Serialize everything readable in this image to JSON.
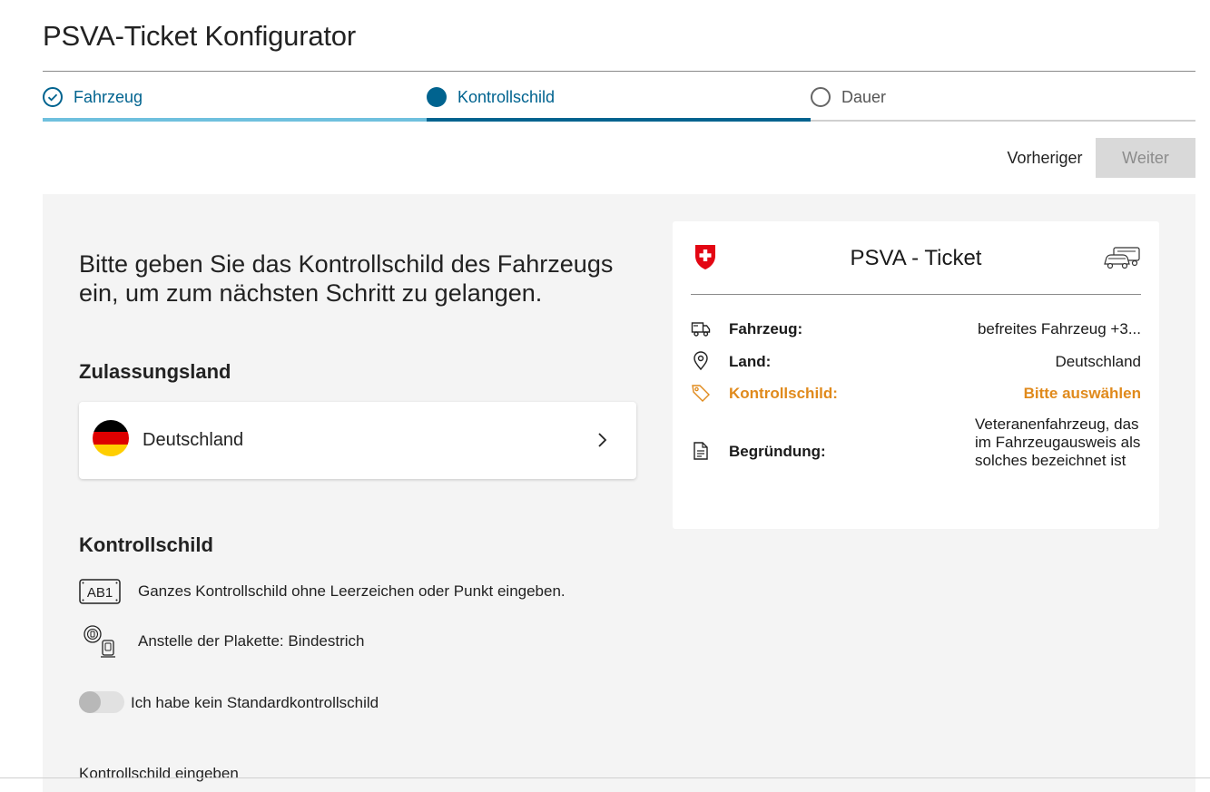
{
  "page": {
    "title": "PSVA-Ticket Konfigurator"
  },
  "stepper": {
    "steps": [
      {
        "label": "Fahrzeug",
        "state": "completed"
      },
      {
        "label": "Kontrollschild",
        "state": "active"
      },
      {
        "label": "Dauer",
        "state": "pending"
      }
    ]
  },
  "navigation": {
    "previous_label": "Vorheriger",
    "next_label": "Weiter",
    "next_disabled": true
  },
  "form": {
    "intro": "Bitte geben Sie das Kontrollschild des Fahrzeugs ein, um zum nächsten Schritt zu gelangen.",
    "country_section_title": "Zulassungsland",
    "country": {
      "name": "Deutschland",
      "flag_colors": [
        "#000000",
        "#dd0000",
        "#ffce00"
      ]
    },
    "plate_section_title": "Kontrollschild",
    "plate_icon_text": "AB1",
    "hints": [
      "Ganzes Kontrollschild ohne Leerzeichen oder Punkt eingeben.",
      "Anstelle der Plakette: Bindestrich"
    ],
    "non_standard_toggle": {
      "label": "Ich habe kein Standardkontrollschild",
      "checked": false
    },
    "plate_input_label": "Kontrollschild eingeben"
  },
  "summary": {
    "title": "PSVA - Ticket",
    "rows": [
      {
        "icon": "truck-icon",
        "label": "Fahrzeug:",
        "value": "befreites Fahrzeug +3..."
      },
      {
        "icon": "location-pin-icon",
        "label": "Land:",
        "value": "Deutschland"
      },
      {
        "icon": "tag-icon",
        "label": "Kontrollschild:",
        "value": "Bitte auswählen",
        "highlight": true
      },
      {
        "icon": "document-icon",
        "label": "Begründung:",
        "value": "Veteranenfahrzeug, das im Fahrzeugausweis als solches bezeichnet ist"
      }
    ]
  },
  "colors": {
    "primary": "#00638f",
    "progress_light": "#6fc0de",
    "highlight": "#e08a1c",
    "swiss_red": "#e30613"
  }
}
